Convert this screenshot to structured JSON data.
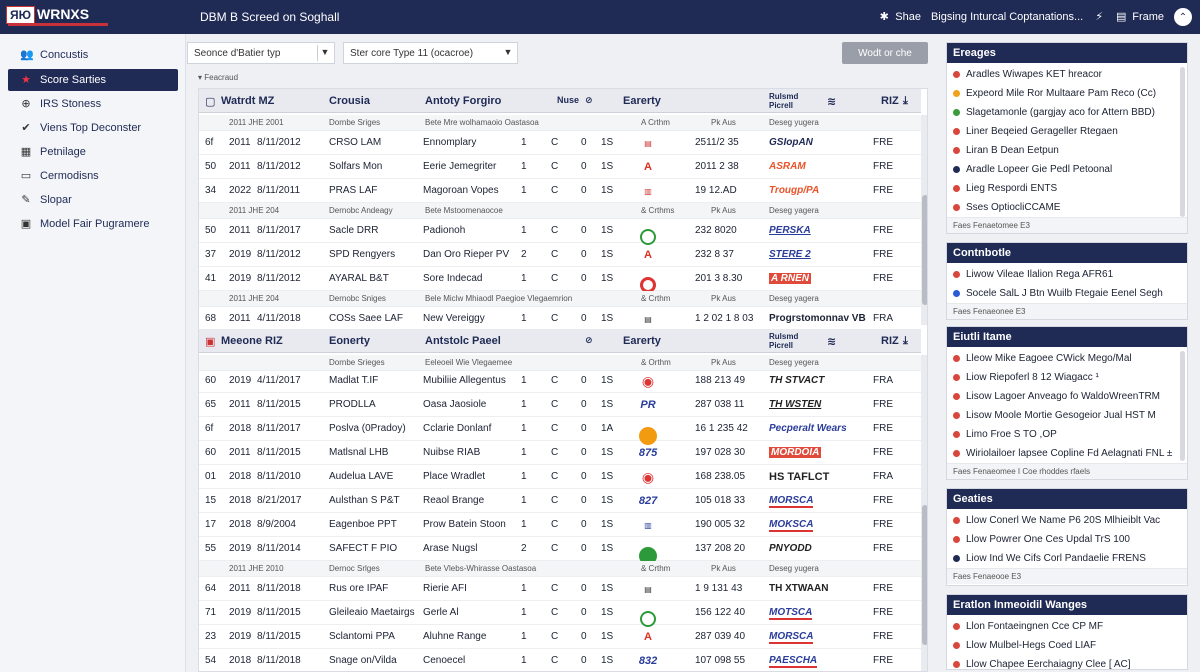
{
  "header": {
    "brand_box": "ЯЮ",
    "brand_text": "WRNXS",
    "page_title": "DBM B Screed on Soghall",
    "share": "Shae",
    "notice": "Bigsing Inturcal Coptanations...",
    "frame": "Frame",
    "colors": {
      "bar": "#1f2a55"
    }
  },
  "sidebar": {
    "items": [
      {
        "label": "Concustis",
        "icon": "people-icon"
      },
      {
        "label": "Score Sarties",
        "icon": "star-icon",
        "active": true
      },
      {
        "label": "IRS Stoness",
        "icon": "globe-icon"
      },
      {
        "label": "Viens Top Deconster",
        "icon": "twitter-icon"
      },
      {
        "label": "Petnilage",
        "icon": "calendar-icon"
      },
      {
        "label": "Cermodisns",
        "icon": "monitor-icon"
      },
      {
        "label": "Slopar",
        "icon": "feather-icon"
      },
      {
        "label": "Model Fair Pugramere",
        "icon": "document-icon"
      }
    ]
  },
  "filters": {
    "filter1": "Seonce d'Batier typ",
    "filter2": "Ster core Type 11 (ocacroe)",
    "action_button": "Wodt or che",
    "section_note": "Feacraud"
  },
  "table": {
    "section1": {
      "header": [
        "Watrdt MZ",
        "Crousia",
        "Antoty Forgiro",
        "Nuse",
        "Earerty",
        "Rulsmd Picrell",
        "RIZ"
      ],
      "subheads": [
        [
          "2011 JHE 2001",
          "Dornbe Sriges",
          "Bete Mre wolhamaoio Oastasoa",
          "A Crthm",
          "Pk Aus",
          "Deseg yugera"
        ],
        [
          "2011 JHE 204",
          "Dernobc Andeagy",
          "Bete Mstoomenaocoe",
          "& Crthms",
          "Pk Aus",
          "Deseg yagera"
        ],
        [
          "2011 JHE 204",
          "Dernobc Sniges",
          "Bele Miclw Mhiaodl Paegioe Vlegaemrion",
          "& Crthm",
          "Pk Aus",
          "Deseg yagera"
        ]
      ],
      "rows": [
        [
          "6f",
          "2011",
          "8/11/2012",
          "CRSO LAM",
          "Ennomplary",
          "1",
          "C",
          "0",
          "1S",
          "logo",
          "2511/2 35",
          "GSIopAN",
          "FRE"
        ],
        [
          "50",
          "2011",
          "8/11/2012",
          "Solfars Mon",
          "Eerie Jemegriter",
          "1",
          "C",
          "0",
          "1S",
          "logo",
          "2011 2 38",
          "ASRAM",
          "FRE"
        ],
        [
          "34",
          "2022",
          "8/11/2011",
          "PRAS LAF",
          "Magoroan Vopes",
          "1",
          "C",
          "0",
          "1S",
          "logo",
          "19 12.AD",
          "Trougp/PA",
          "FRE"
        ],
        [
          "50",
          "2011",
          "8/11/2017",
          "Sacle DRR",
          "Padionoh",
          "1",
          "C",
          "0",
          "1S",
          "logo",
          "232 8020",
          "PERSKA",
          "FRE"
        ],
        [
          "37",
          "2019",
          "8/11/2012",
          "SPD Rengyers",
          "Dan Oro Rieper PV",
          "2",
          "C",
          "0",
          "1S",
          "logo",
          "232 8 37",
          "STERE 2",
          "FRE"
        ],
        [
          "41",
          "2019",
          "8/11/2012",
          "AYARAL B&T",
          "Sore Indecad",
          "1",
          "C",
          "0",
          "1S",
          "logo",
          "201 3 8.30",
          "A RNEN",
          "FRE"
        ],
        [
          "68",
          "2011",
          "4/11/2018",
          "COSs Saee LAF",
          "New Vereiggy",
          "1",
          "C",
          "0",
          "1S",
          "logo",
          "1 2 02 1 8 03",
          "Progrstomonnav VB",
          "FRA"
        ]
      ]
    },
    "section2": {
      "header": [
        "Meeone RIZ",
        "Eonerty",
        "Antstolc Paeel",
        "Earerty",
        "Rulsmd Picrell",
        "RIZ"
      ],
      "subheads": [
        [
          "",
          "Dornbe Srieges",
          "Eeleoeil Wie Vlegaemee",
          "& Orthm",
          "Pk Aus",
          "Deseg yegera"
        ],
        [
          "2011 JHE 2010",
          "Dernoc Srlges",
          "Bete Vlebs-Whirasse Oastasoa",
          "& Crthm",
          "Pk Aus",
          "Deseg yugera"
        ]
      ],
      "rows": [
        [
          "60",
          "2019",
          "4/11/2017",
          "Madlat T.IF",
          "Mubiliie Allegentus",
          "1",
          "C",
          "0",
          "1S",
          "logo",
          "188 213 49",
          "TH STVACT",
          "FRA"
        ],
        [
          "65",
          "2011",
          "8/11/2015",
          "PRODLLA",
          "Oasa Jaosiole",
          "1",
          "C",
          "0",
          "1S",
          "logo",
          "287 038 11",
          "TH WSTEN",
          "FRE"
        ],
        [
          "6f",
          "2018",
          "8/11/2017",
          "Poslva (0Pradoy)",
          "Cclarie Donlanf",
          "1",
          "C",
          "0",
          "1A",
          "logo",
          "16 1 235 42",
          "Pecperalt Wears",
          "FRE"
        ],
        [
          "60",
          "2011",
          "8/11/2015",
          "Matlsnal LHB",
          "Nuibse RIAB",
          "1",
          "C",
          "0",
          "1S",
          "logo",
          "197 028 30",
          "MORDOIA",
          "FRE"
        ],
        [
          "01",
          "2018",
          "8/11/2010",
          "Audelua LAVE",
          "Place Wradlet",
          "1",
          "C",
          "0",
          "1S",
          "logo",
          "168 238.05",
          "HS TAFLCT",
          "FRA"
        ],
        [
          "15",
          "2018",
          "8/21/2017",
          "Aulsthan S P&T",
          "Reaol Brange",
          "1",
          "C",
          "0",
          "1S",
          "logo",
          "105 018 33",
          "MORSCA",
          "FRE"
        ],
        [
          "17",
          "2018",
          "8/9/2004",
          "Eagenboe PPT",
          "Prow Batein Stoon",
          "1",
          "C",
          "0",
          "1S",
          "logo",
          "190 005 32",
          "MOKSCA",
          "FRE"
        ],
        [
          "55",
          "2019",
          "8/11/2014",
          "SAFECT F PIO",
          "Arase Nugsl",
          "2",
          "C",
          "0",
          "1S",
          "logo",
          "137 208 20",
          "PNYODD",
          "FRE"
        ],
        [
          "64",
          "2011",
          "8/11/2018",
          "Rus ore IPAF",
          "Rierie AFI",
          "1",
          "C",
          "0",
          "1S",
          "logo",
          "1 9 131 43",
          "TH XTWAAN",
          "FRE"
        ],
        [
          "71",
          "2019",
          "8/11/2015",
          "Gleileaio Maetairgs",
          "Gerle Al",
          "1",
          "C",
          "0",
          "1S",
          "logo",
          "156 122 40",
          "MOTSCA",
          "FRE"
        ],
        [
          "23",
          "2019",
          "8/11/2015",
          "Sclantomi PPA",
          "Aluhne Range",
          "1",
          "C",
          "0",
          "1S",
          "logo",
          "287 039 40",
          "MORSCA",
          "FRE"
        ],
        [
          "54",
          "2018",
          "8/11/2018",
          "Snage on/Vilda",
          "Cenoecel",
          "1",
          "C",
          "0",
          "1S",
          "logo",
          "107 098 55",
          "PAESCHA",
          "FRE"
        ]
      ]
    }
  },
  "panels": {
    "engages": {
      "title": "Ereages",
      "items": [
        {
          "text": "Aradles Wiwapes KET hreacor",
          "color": "#d9463b"
        },
        {
          "text": "Expeord Mile Ror Multaare Pam Reco (Cc)",
          "color": "#f0a21a"
        },
        {
          "text": "Slagetamonle (gargjay aco for Attern BBD)",
          "color": "#3b9a3b"
        },
        {
          "text": "Liner Beqeied Gerageller Rtegaen",
          "color": "#d9463b"
        },
        {
          "text": "Liran B Dean Eetpun",
          "color": "#d9463b"
        },
        {
          "text": "Aradle Lopeer Gie Pedl Petoonal",
          "color": "#1f2a55"
        },
        {
          "text": "Lieg Respordi ENTS",
          "color": "#d9463b"
        },
        {
          "text": "Sses OptiocliCCAME",
          "color": "#d9463b"
        }
      ],
      "foot": "Faes Fenaetomee E3"
    },
    "contribute": {
      "title": "Contnbotle",
      "items": [
        {
          "text": "Liwow Vileae Ilalion Rega AFR61",
          "color": "#d9463b"
        },
        {
          "text": "Socele SalL J Btn Wuilb Ftegaie Eenel Segh",
          "color": "#2a5bd7"
        }
      ],
      "foot": "Faes Fenaeonee E3"
    },
    "build": {
      "title": "Eiutli Itame",
      "items": [
        {
          "text": "Lleow Mike Eagoee CWick Mego/Mal",
          "color": "#d9463b"
        },
        {
          "text": "Liow Riepoferl 8 12 Wiagacc ¹",
          "color": "#d9463b"
        },
        {
          "text": "Lisow Lagoer Anveago fo WaldoWreenTRM",
          "color": "#d9463b"
        },
        {
          "text": "Lisow Moole Mortie Gesogeior Jual HST M",
          "color": "#d9463b"
        },
        {
          "text": "Limo Froe S TO ,OP",
          "color": "#d9463b"
        },
        {
          "text": "Wiriolailoer lapsee Copline Fd Aelagnati FNL ±",
          "color": "#d9463b"
        }
      ],
      "foot": "Faes Fenaeomee I Coe rhoddes rfaels"
    },
    "gates": {
      "title": "Geaties",
      "items": [
        {
          "text": "Llow Conerl We Name P6 20S Mlhieiblt Vac",
          "color": "#d9463b"
        },
        {
          "text": "Llow Powrer One Ces Updal TrS 100",
          "color": "#d9463b"
        },
        {
          "text": "Liow Ind We Cifs Corl Pandaelie FRENS",
          "color": "#1f2a55"
        }
      ],
      "foot": "Faes Fenaeooe E3"
    },
    "station": {
      "title": "Eratlon Inmeoidil Wanges",
      "items": [
        {
          "text": "Llon Fontaeingnen Cce CP MF",
          "color": "#d9463b"
        },
        {
          "text": "Llow Mulbel-Hegs Coed LIAF",
          "color": "#d9463b"
        },
        {
          "text": "Llow Chapee Eerchaiagny Clee [ AC]",
          "color": "#d9463b"
        }
      ]
    }
  }
}
